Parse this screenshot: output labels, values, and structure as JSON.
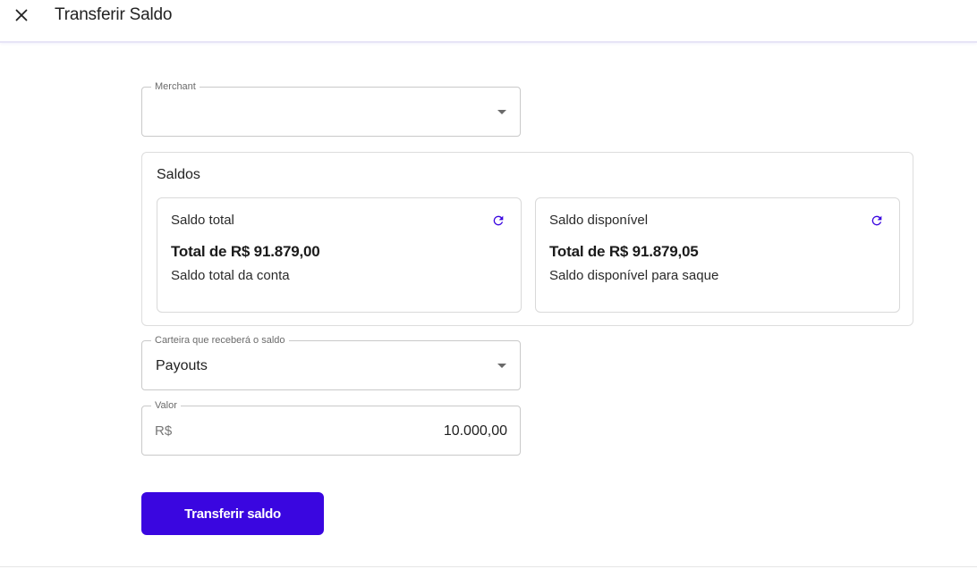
{
  "header": {
    "title": "Transferir Saldo",
    "close_icon": "close-icon"
  },
  "merchant_field": {
    "label": "Merchant",
    "value": ""
  },
  "saldos": {
    "title": "Saldos",
    "total_card": {
      "title": "Saldo total",
      "amount": "Total de R$ 91.879,00",
      "description": "Saldo total da conta",
      "refresh_icon": "refresh-icon"
    },
    "available_card": {
      "title": "Saldo disponível",
      "amount": "Total de R$ 91.879,05",
      "description": "Saldo disponível para saque",
      "refresh_icon": "refresh-icon"
    }
  },
  "wallet_field": {
    "label": "Carteira que receberá o saldo",
    "value": "Payouts"
  },
  "value_field": {
    "label": "Valor",
    "prefix": "R$",
    "value": "10.000,00"
  },
  "submit": {
    "label": "Transferir saldo"
  },
  "colors": {
    "accent": "#3a06e0",
    "icon": "#3a06e0"
  }
}
